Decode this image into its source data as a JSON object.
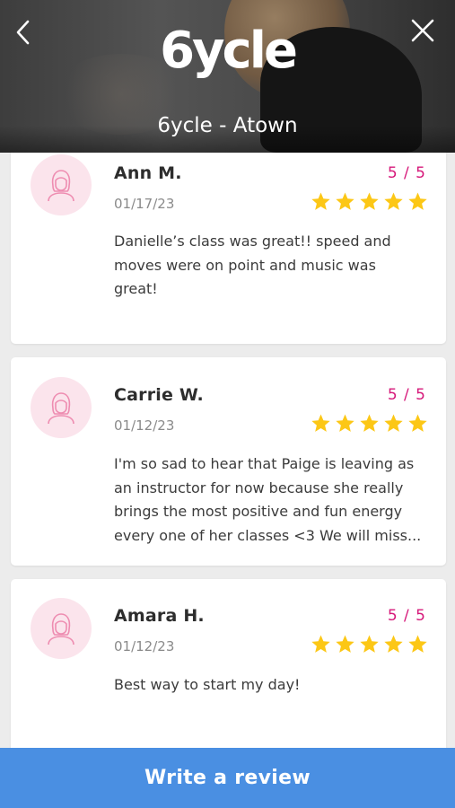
{
  "header": {
    "logo_text": "6ycle",
    "studio_name": "6ycle - Atown",
    "back_icon": "chevron-left-icon",
    "close_icon": "close-icon"
  },
  "colors": {
    "accent_pink": "#d6197a",
    "star_yellow": "#fcc716",
    "avatar_bg": "#fbe4ec",
    "button_blue": "#4a8fe2"
  },
  "reviews": [
    {
      "name": "Ann M.",
      "date": "01/17/23",
      "score": "5 / 5",
      "rating": 5,
      "text": "Danielle’s class was great!! speed and moves were on point and music was great!"
    },
    {
      "name": "Carrie W.",
      "date": "01/12/23",
      "score": "5 / 5",
      "rating": 5,
      "text": "I'm so sad to hear that Paige is leaving as an instructor for now because she really brings the most positive and fun energy every one of her classes <3 We will miss..."
    },
    {
      "name": "Amara H.",
      "date": "01/12/23",
      "score": "5 / 5",
      "rating": 5,
      "text": "Best way to start my day!"
    }
  ],
  "footer": {
    "write_review_label": "Write a review"
  }
}
